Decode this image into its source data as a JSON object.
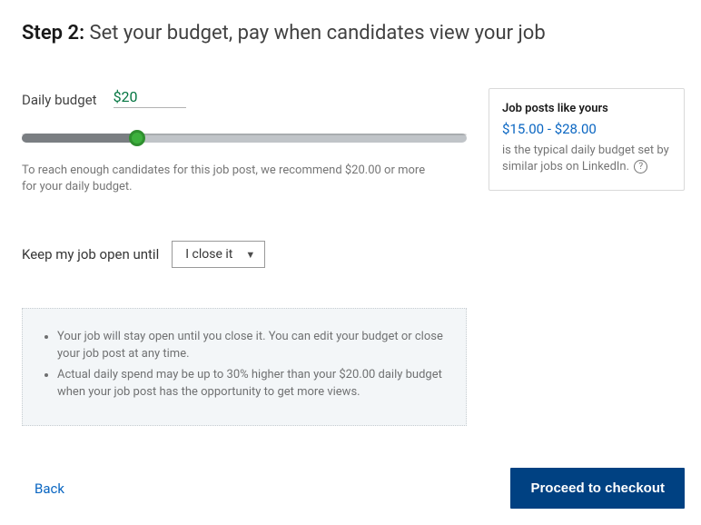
{
  "heading": {
    "step_label": "Step 2:",
    "title": "Set your budget, pay when candidates view your job"
  },
  "budget": {
    "label": "Daily budget",
    "value": "$20",
    "helper": "To reach enough candidates for this job post, we recommend $20.00 or more for your daily budget.",
    "slider_percent": 26
  },
  "keep_open": {
    "label": "Keep my job open until",
    "selected": "I close it"
  },
  "info_card": {
    "title": "Job posts like yours",
    "range": "$15.00 - $28.00",
    "desc": "is the typical daily budget set by similar jobs on LinkedIn."
  },
  "notes": {
    "items": [
      "Your job will stay open until you close it. You can edit your budget or close your job post at any time.",
      "Actual daily spend may be up to 30% higher than your $20.00 daily budget when your job post has the opportunity to get more views."
    ]
  },
  "footer": {
    "back": "Back",
    "proceed": "Proceed to checkout"
  }
}
